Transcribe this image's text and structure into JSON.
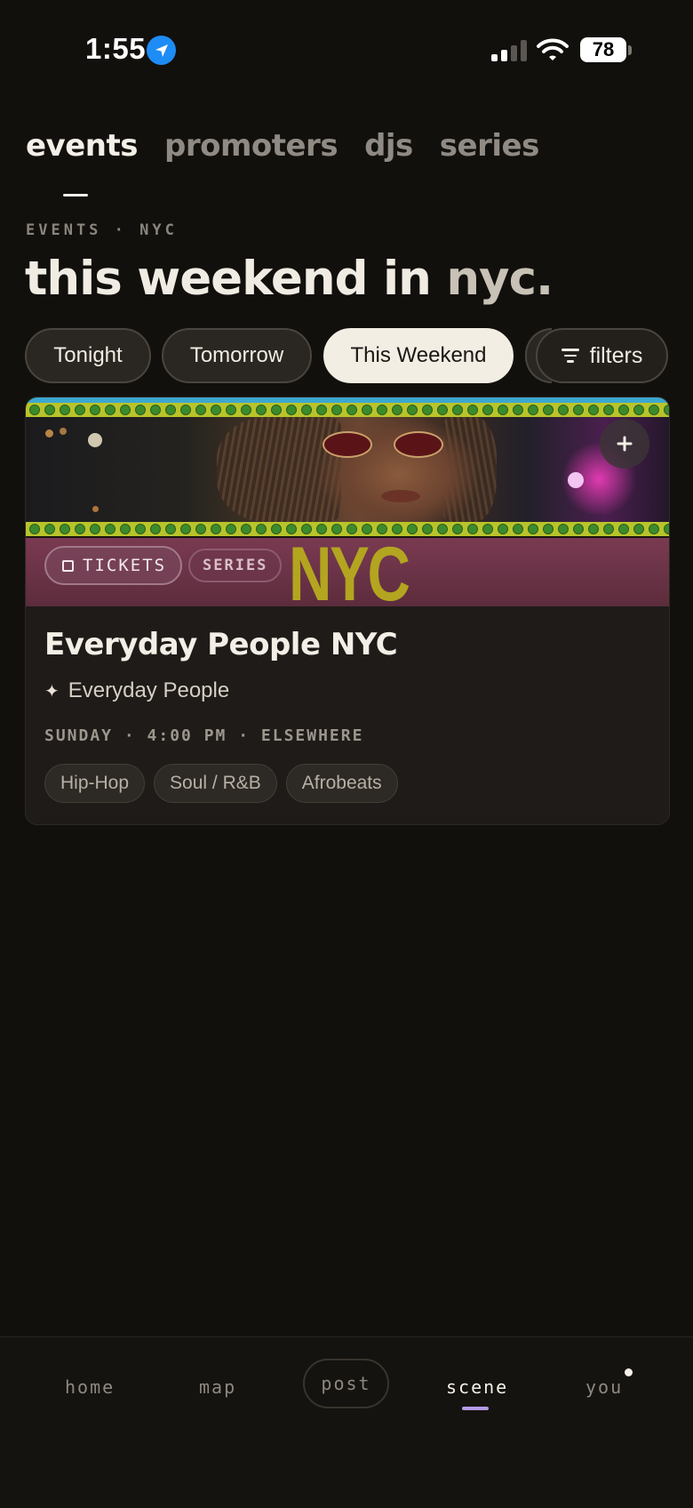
{
  "status_bar": {
    "time": "1:55",
    "battery": "78"
  },
  "tabs": [
    {
      "label": "events"
    },
    {
      "label": "promoters"
    },
    {
      "label": "djs"
    },
    {
      "label": "series"
    }
  ],
  "eyebrow": "EVENTS · NYC",
  "headline": {
    "text": "this weekend in ",
    "city": "nyc."
  },
  "chips": [
    {
      "label": "Tonight"
    },
    {
      "label": "Tomorrow"
    },
    {
      "label": "This Weekend"
    }
  ],
  "filters_label": "filters",
  "event": {
    "title": "Everyday People NYC",
    "promoter": "Everyday People",
    "meta": "SUNDAY · 4:00 PM · ELSEWHERE",
    "tickets_label": "TICKETS",
    "series_label": "SERIES",
    "tags": [
      "Hip-Hop",
      "Soul / R&B",
      "Afrobeats"
    ]
  },
  "bottom_nav": {
    "home": "home",
    "map": "map",
    "post": "post",
    "scene": "scene",
    "you": "you"
  },
  "colors": {
    "background": "#12100d",
    "active_chip": "#f3eee4",
    "nav_indicator": "#b49ae8",
    "location_icon": "#1e8cf5"
  }
}
